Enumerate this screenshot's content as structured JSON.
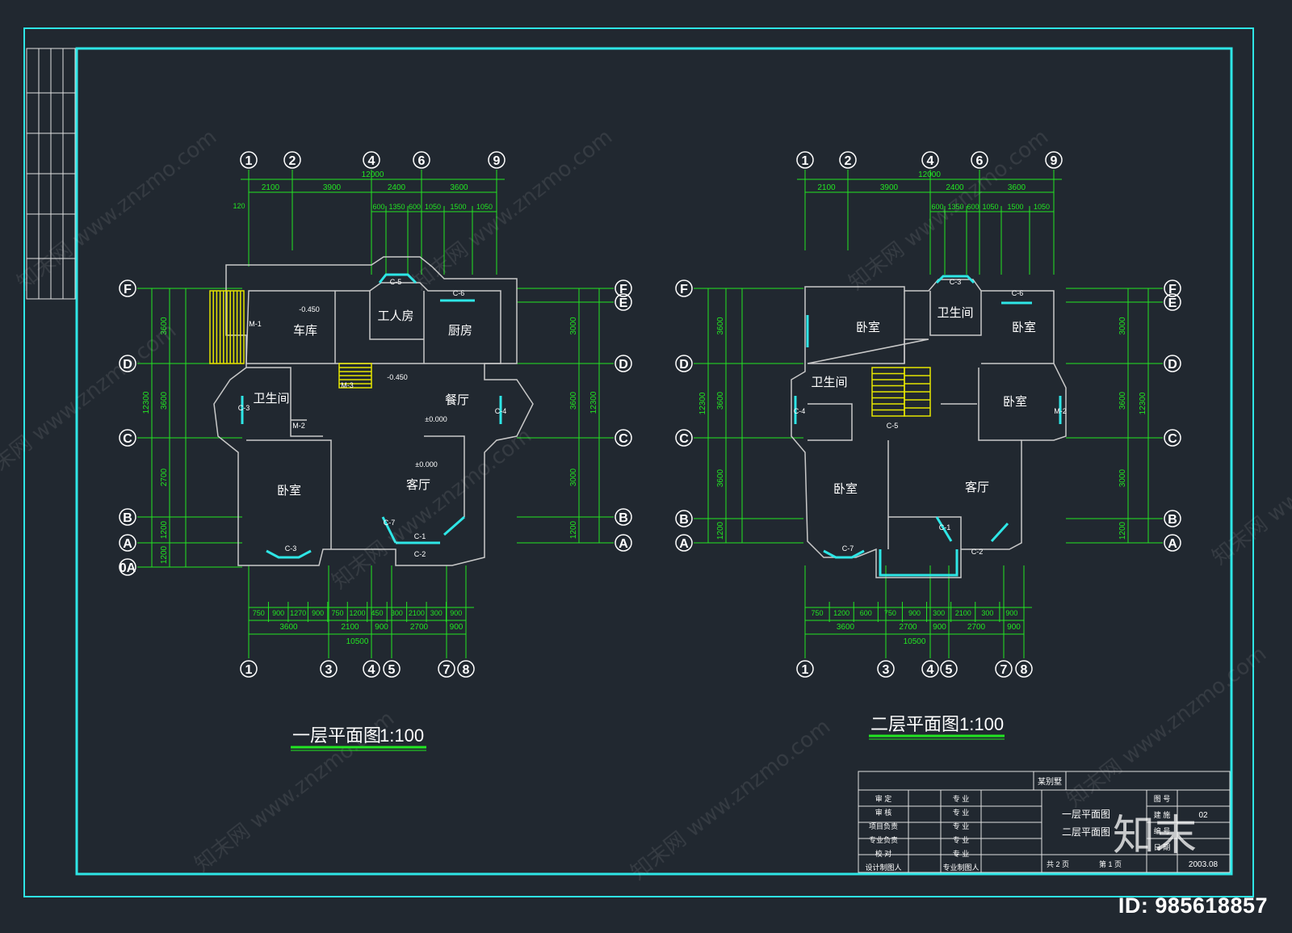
{
  "colors": {
    "background": "#212830",
    "frame": "#2ee6e6",
    "wall": "#c9c9c9",
    "dimension": "#22e622",
    "window": "#2ee6e6",
    "stair": "#e6e600",
    "text": "#ffffff"
  },
  "plan1": {
    "title": "一层平面图",
    "scale": "1:100",
    "axes_top": [
      "1",
      "2",
      "4",
      "6",
      "9"
    ],
    "axes_bottom": [
      "1",
      "3",
      "4",
      "5",
      "7",
      "8"
    ],
    "axes_left": [
      "F",
      "D",
      "C",
      "B",
      "A",
      "0A"
    ],
    "axes_right": [
      "F",
      "E",
      "D",
      "C",
      "B",
      "A"
    ],
    "dims_top_total": "12000",
    "dims_top_row1": [
      "2100",
      "3900",
      "2400",
      "3600"
    ],
    "dims_top_row2": [
      "600",
      "1350",
      "600",
      "1050",
      "1500",
      "1050"
    ],
    "dims_top_120": "120",
    "dims_bottom_row1": [
      "750",
      "900",
      "1270",
      "900",
      "750",
      "1200",
      "450",
      "300",
      "2100",
      "300",
      "900"
    ],
    "dims_bottom_row2": [
      "3600",
      "2100",
      "900",
      "2700",
      "900"
    ],
    "dims_bottom_total": "10500",
    "dims_left": [
      "3600",
      "3600",
      "2700",
      "1200",
      "1200"
    ],
    "dims_right": [
      "3000",
      "3600",
      "3000",
      "1200"
    ],
    "dims_right_total": "12300",
    "rooms": {
      "garage": "车库",
      "worker": "工人房",
      "kitchen": "厨房",
      "bath": "卫生间",
      "dining": "餐厅",
      "bedroom": "卧室",
      "living": "客厅"
    },
    "levels": [
      "-0.450",
      "±0.000",
      "-0.450",
      "±0.000"
    ],
    "labels": [
      "M-1",
      "C-5",
      "C-6",
      "C-3",
      "M-2",
      "C-4",
      "M-3",
      "C-7",
      "C-1",
      "C-2",
      "C-3"
    ]
  },
  "plan2": {
    "title": "二层平面图",
    "scale": "1:100",
    "axes_top": [
      "1",
      "2",
      "4",
      "6",
      "9"
    ],
    "axes_bottom": [
      "1",
      "3",
      "4",
      "5",
      "7",
      "8"
    ],
    "axes_left": [
      "F",
      "D",
      "C",
      "B",
      "A"
    ],
    "axes_right": [
      "F",
      "E",
      "D",
      "C",
      "B",
      "A"
    ],
    "dims_top_total": "12000",
    "dims_top_row1": [
      "2100",
      "3900",
      "2400",
      "3600"
    ],
    "dims_top_row2": [
      "600",
      "1350",
      "600",
      "1050",
      "1500",
      "1050"
    ],
    "dims_bottom_row1": [
      "750",
      "1200",
      "600",
      "750",
      "900",
      "300",
      "2100",
      "300",
      "900"
    ],
    "dims_bottom_row2": [
      "3600",
      "2700",
      "900",
      "2700",
      "900"
    ],
    "dims_bottom_total": "10500",
    "dims_left": [
      "3600",
      "3600",
      "3600",
      "1200"
    ],
    "dims_right": [
      "3000",
      "3600",
      "3000",
      "1200"
    ],
    "dims_right_total": "12300",
    "rooms": {
      "bedroom_nw": "卧室",
      "bath_n": "卫生间",
      "bedroom_ne": "卧室",
      "bath_w": "卫生间",
      "bedroom_e": "卧室",
      "bedroom_sw": "卧室",
      "living": "客厅"
    },
    "labels": [
      "C-3",
      "C-6",
      "C-4",
      "M-2",
      "C-5",
      "C-7",
      "C-1",
      "C-2"
    ]
  },
  "watermark": "知末网 www.znzmo.com",
  "brand_mark": "知末",
  "id_text": "ID: 985618857",
  "title_block": {
    "project": "某别墅",
    "drawing_names": [
      "一层平面图",
      "二层平面图"
    ],
    "left_labels": [
      "审 定",
      "审 核",
      "项目负责",
      "专业负责",
      "校 对",
      "设计制图人"
    ],
    "mid_labels": [
      "专 业",
      "专 业",
      "专 业",
      "专 业",
      "专 业",
      "专业制图人"
    ],
    "right_labels": [
      "图 号",
      "建 施",
      "编 号",
      "日 期"
    ],
    "drawing_no": "02",
    "date": "2003.08",
    "sheet": "共 2 页",
    "page": "第 1 页"
  }
}
